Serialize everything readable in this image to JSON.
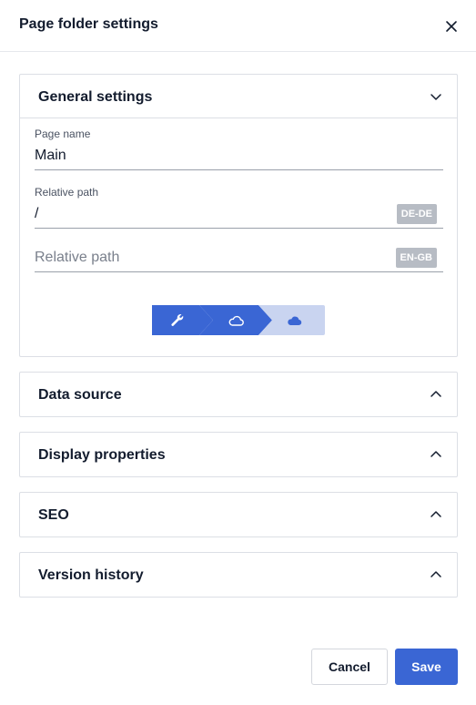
{
  "dialog": {
    "title": "Page folder settings"
  },
  "sections": {
    "general": {
      "title": "General settings",
      "page_name_label": "Page name",
      "page_name_value": "Main",
      "relative_path_label": "Relative path",
      "relative_path_value": "/",
      "relative_path_locale": "DE-DE",
      "relative_path_2_placeholder": "Relative path",
      "relative_path_2_locale": "EN-GB"
    },
    "data_source": {
      "title": "Data source"
    },
    "display_properties": {
      "title": "Display properties"
    },
    "seo": {
      "title": "SEO"
    },
    "version_history": {
      "title": "Version history"
    }
  },
  "status_steps": {
    "steps": [
      "wrench-icon",
      "cloud-outline-icon",
      "cloud-filled-icon"
    ],
    "active_color": "#3a66d4",
    "inactive_color": "#c9d4f0"
  },
  "footer": {
    "cancel_label": "Cancel",
    "save_label": "Save"
  },
  "colors": {
    "accent": "#3a66d4",
    "badge": "#b7bcc4"
  }
}
